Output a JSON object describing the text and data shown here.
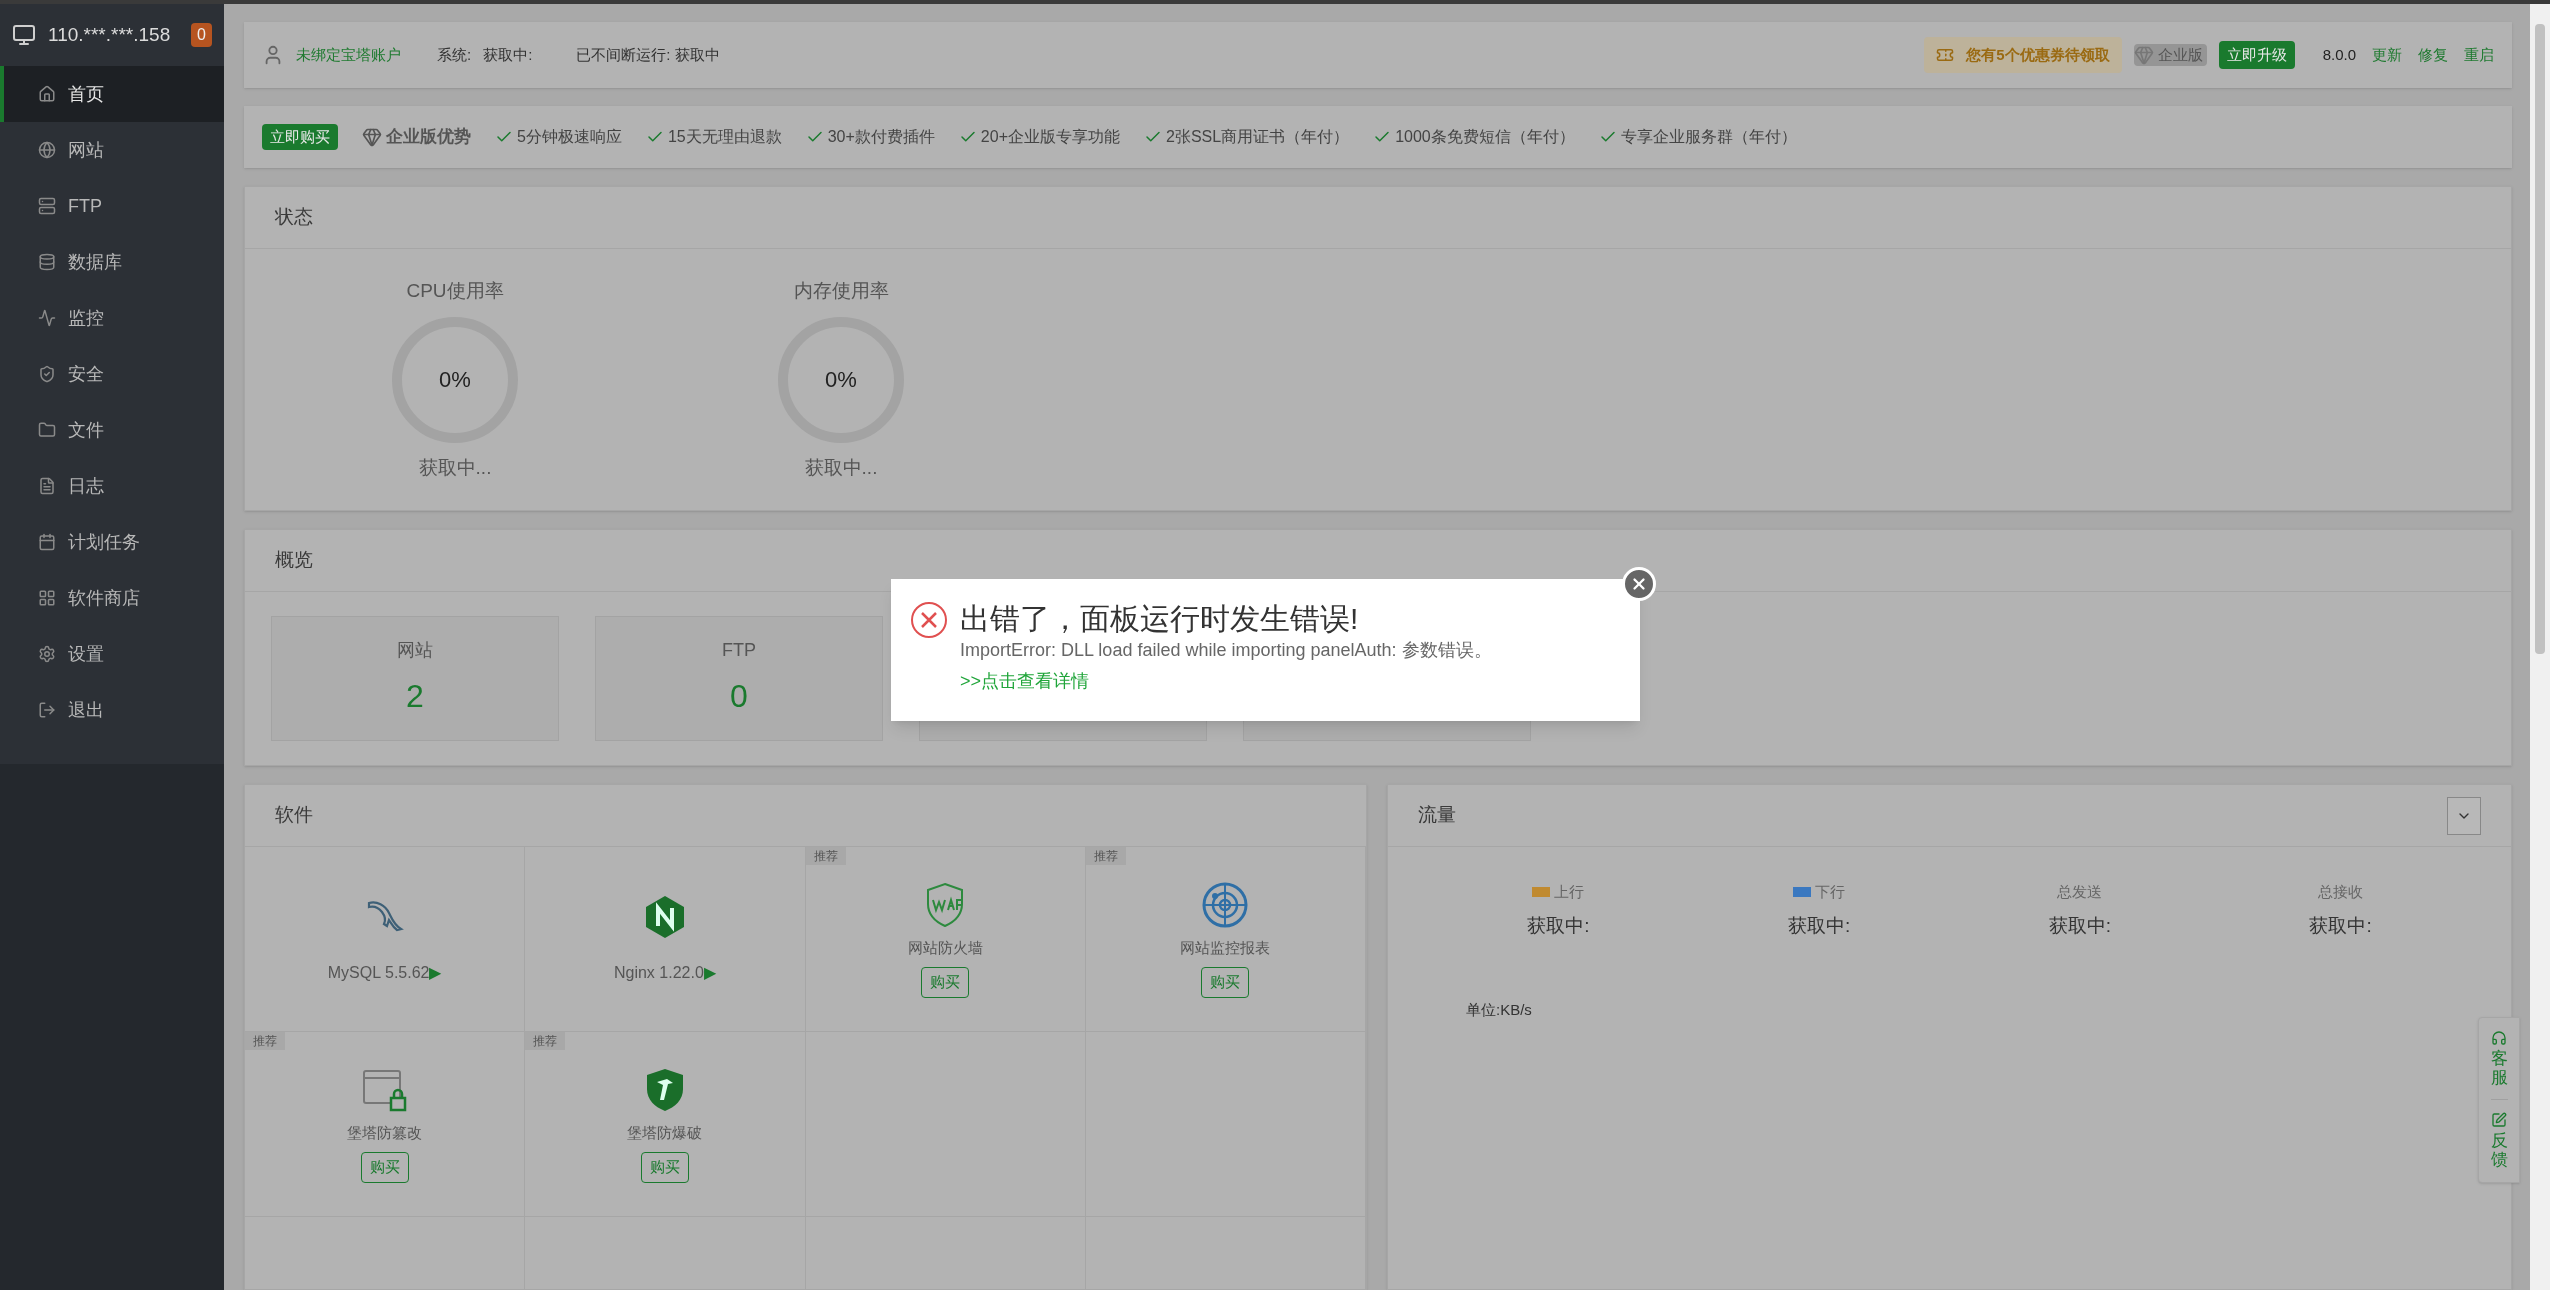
{
  "sidebar": {
    "host": "110.***.***.158",
    "badge": "0",
    "items": [
      {
        "label": "首页",
        "selected": true
      },
      {
        "label": "网站",
        "selected": false
      },
      {
        "label": "FTP",
        "selected": false
      },
      {
        "label": "数据库",
        "selected": false
      },
      {
        "label": "监控",
        "selected": false
      },
      {
        "label": "安全",
        "selected": false
      },
      {
        "label": "文件",
        "selected": false
      },
      {
        "label": "日志",
        "selected": false
      },
      {
        "label": "计划任务",
        "selected": false
      },
      {
        "label": "软件商店",
        "selected": false
      },
      {
        "label": "设置",
        "selected": false
      },
      {
        "label": "退出",
        "selected": false
      }
    ]
  },
  "topbar": {
    "account": "未绑定宝塔账户",
    "system_label": "系统:",
    "system_value": "获取中:",
    "uptime": "已不间断运行: 获取中",
    "coupon": "您有5个优惠券待领取",
    "edition": "企业版",
    "upgrade": "立即升级",
    "version": "8.0.0",
    "links": [
      "更新",
      "修复",
      "重启"
    ]
  },
  "promo": {
    "buy": "立即购买",
    "title": "企业版优势",
    "features": [
      "5分钟极速响应",
      "15天无理由退款",
      "30+款付费插件",
      "20+企业版专享功能",
      "2张SSL商用证书（年付）",
      "1000条免费短信（年付）",
      "专享企业服务群（年付）"
    ]
  },
  "status": {
    "title": "状态",
    "gauges": [
      {
        "label": "CPU使用率",
        "value": "0%",
        "caption": "获取中..."
      },
      {
        "label": "内存使用率",
        "value": "0%",
        "caption": "获取中..."
      }
    ]
  },
  "overview": {
    "title": "概览",
    "cards": [
      {
        "label": "网站",
        "value": "2"
      },
      {
        "label": "FTP",
        "value": "0"
      }
    ]
  },
  "software": {
    "title": "软件",
    "items": [
      {
        "kind": "installed",
        "name": "MySQL 5.5.62",
        "arrow": "▶"
      },
      {
        "kind": "installed",
        "name": "Nginx 1.22.0",
        "arrow": "▶"
      },
      {
        "kind": "recommended",
        "tag": "推荐",
        "name": "网站防火墙",
        "button": "购买"
      },
      {
        "kind": "recommended",
        "tag": "推荐",
        "name": "网站监控报表",
        "button": "购买"
      },
      {
        "kind": "recommended",
        "tag": "推荐",
        "name": "堡塔防篡改",
        "button": "购买"
      },
      {
        "kind": "recommended",
        "tag": "推荐",
        "name": "堡塔防爆破",
        "button": "购买"
      }
    ]
  },
  "traffic": {
    "title": "流量",
    "stats": [
      {
        "label": "上行",
        "value": "获取中:",
        "color": "#c08a30"
      },
      {
        "label": "下行",
        "value": "获取中:",
        "color": "#3a78c0"
      },
      {
        "label": "总发送",
        "value": "获取中:"
      },
      {
        "label": "总接收",
        "value": "获取中:"
      }
    ],
    "unit": "单位:KB/s"
  },
  "float_tools": [
    {
      "label": "客服"
    },
    {
      "label": "反馈"
    }
  ],
  "dialog": {
    "title": "出错了，面板运行时发生错误!",
    "message": "ImportError: DLL load failed while importing panelAuth: 参数错误。",
    "link": ">>点击查看详情"
  }
}
